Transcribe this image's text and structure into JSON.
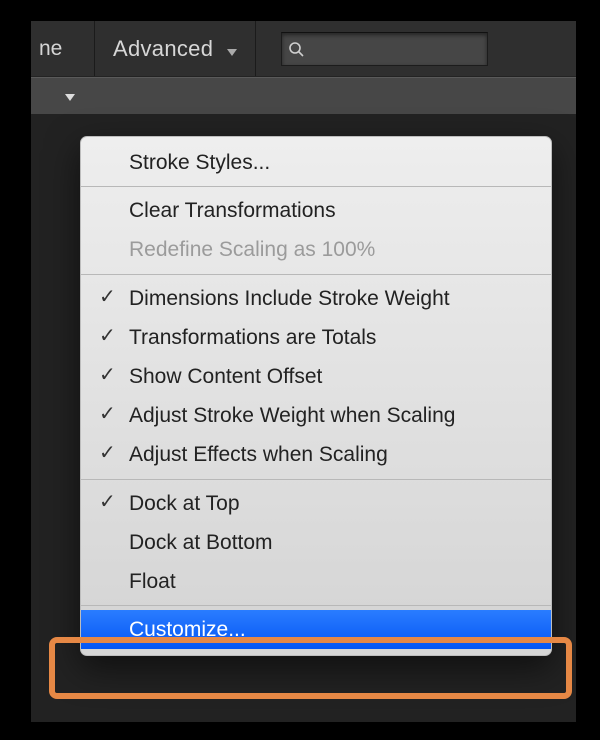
{
  "topbar": {
    "partial_text": "ne",
    "workspace_label": "Advanced",
    "search_placeholder": ""
  },
  "menu": {
    "sections": [
      [
        {
          "label": "Stroke Styles...",
          "checked": false,
          "enabled": true,
          "highlighted": false
        }
      ],
      [
        {
          "label": "Clear Transformations",
          "checked": false,
          "enabled": true,
          "highlighted": false
        },
        {
          "label": "Redefine Scaling as 100%",
          "checked": false,
          "enabled": false,
          "highlighted": false
        }
      ],
      [
        {
          "label": "Dimensions Include Stroke Weight",
          "checked": true,
          "enabled": true,
          "highlighted": false
        },
        {
          "label": "Transformations are Totals",
          "checked": true,
          "enabled": true,
          "highlighted": false
        },
        {
          "label": "Show Content Offset",
          "checked": true,
          "enabled": true,
          "highlighted": false
        },
        {
          "label": "Adjust Stroke Weight when Scaling",
          "checked": true,
          "enabled": true,
          "highlighted": false
        },
        {
          "label": "Adjust Effects when Scaling",
          "checked": true,
          "enabled": true,
          "highlighted": false
        }
      ],
      [
        {
          "label": "Dock at Top",
          "checked": true,
          "enabled": true,
          "highlighted": false
        },
        {
          "label": "Dock at Bottom",
          "checked": false,
          "enabled": true,
          "highlighted": false
        },
        {
          "label": "Float",
          "checked": false,
          "enabled": true,
          "highlighted": false
        }
      ],
      [
        {
          "label": "Customize...",
          "checked": false,
          "enabled": true,
          "highlighted": true
        }
      ]
    ]
  }
}
